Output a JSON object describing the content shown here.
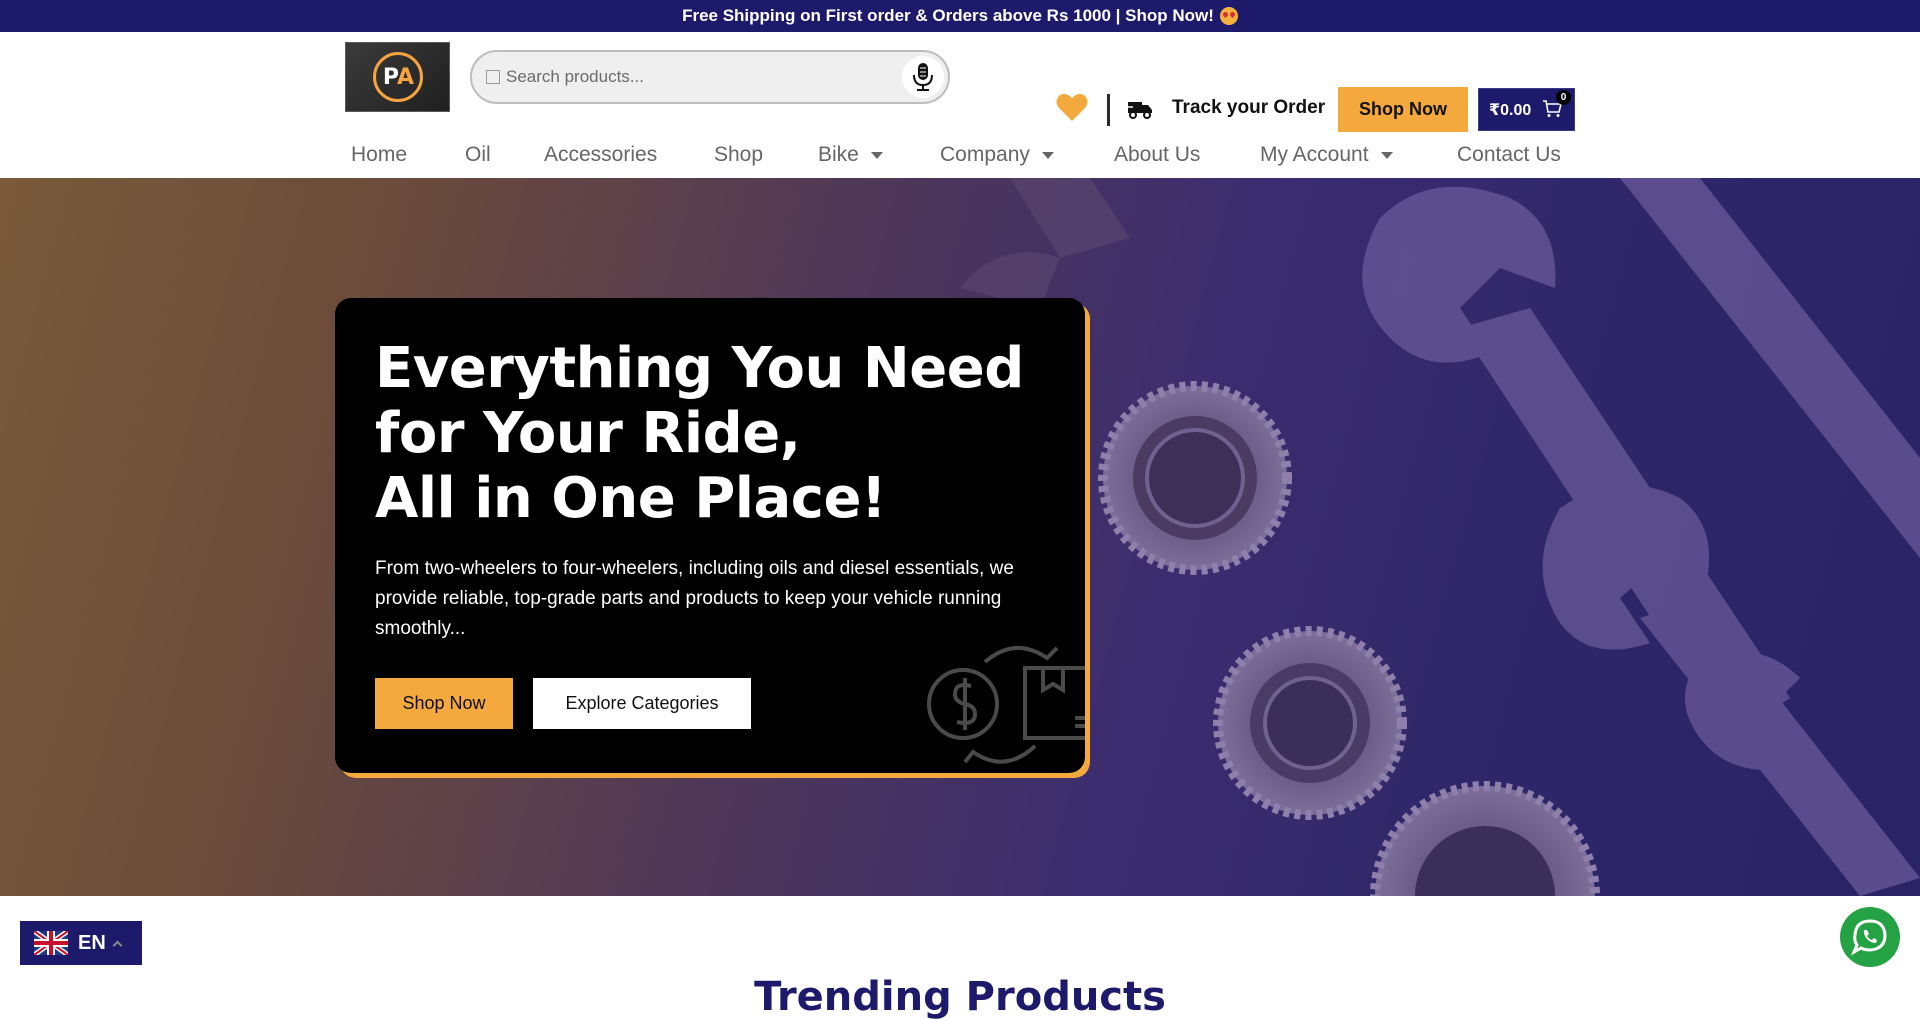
{
  "topbar": {
    "text": "Free Shipping on First order & Orders above Rs 1000 | Shop Now!"
  },
  "header": {
    "logo_text_p": "P",
    "logo_text_a": "A",
    "search_placeholder": "Search products...",
    "track_label": "Track your Order",
    "shop_now_label": "Shop Now",
    "cart_total": "₹0.00",
    "cart_count": "0"
  },
  "nav": {
    "items": [
      {
        "label": "Home"
      },
      {
        "label": "Oil"
      },
      {
        "label": "Accessories"
      },
      {
        "label": "Shop"
      },
      {
        "label": "Bike"
      },
      {
        "label": "Company"
      },
      {
        "label": "About Us"
      },
      {
        "label": "My Account"
      },
      {
        "label": "Contact Us"
      }
    ]
  },
  "hero": {
    "title_line1": "Everything You Need",
    "title_line2": "for Your Ride,",
    "title_line3": "All in One Place!",
    "description": "From two-wheelers to four-wheelers, including oils and diesel essentials, we provide reliable, top-grade parts and products to keep your vehicle running smoothly...",
    "primary_button": "Shop Now",
    "secondary_button": "Explore Categories"
  },
  "language": {
    "code": "EN"
  },
  "section": {
    "title": "Trending Products"
  },
  "colors": {
    "brand_navy": "#1d1a6b",
    "accent_orange": "#f4a93f",
    "whatsapp_green": "#25a244"
  },
  "icons": [
    "heart-icon",
    "truck-icon",
    "cart-icon",
    "microphone-icon",
    "search-icon",
    "whatsapp-icon",
    "uk-flag-icon",
    "exchange-icon"
  ]
}
